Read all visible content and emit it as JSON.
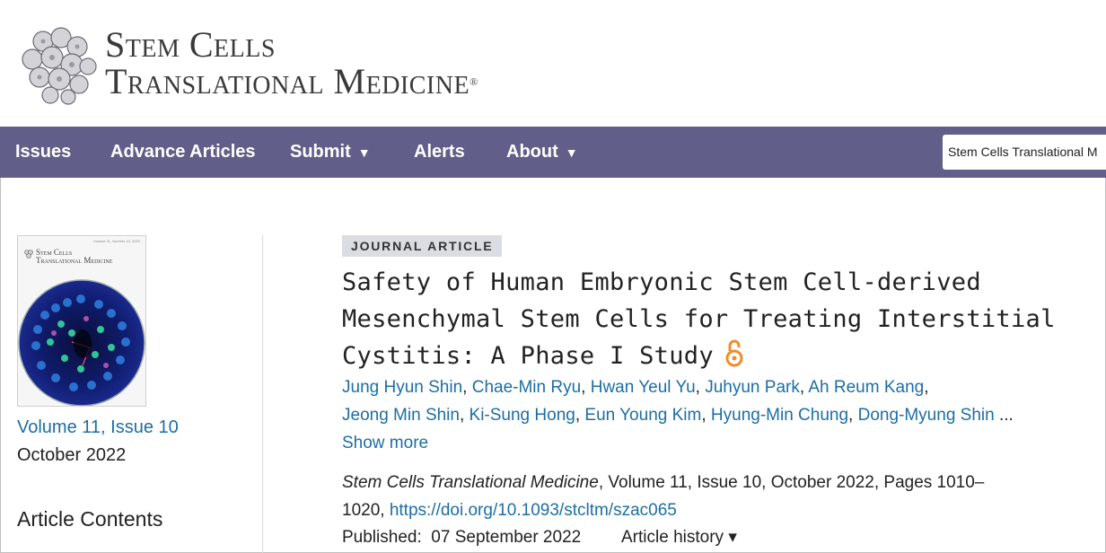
{
  "journal": {
    "logo_line1": "Stem Cells",
    "logo_line2": "Translational Medicine",
    "registered_mark": "®"
  },
  "nav": {
    "items": [
      {
        "label": "Issues"
      },
      {
        "label": "Advance Articles"
      },
      {
        "label": "Submit",
        "caret": "▼"
      },
      {
        "label": "Alerts"
      },
      {
        "label": "About",
        "caret": "▼"
      }
    ],
    "search_scope": "Stem Cells Translational M"
  },
  "sidebar": {
    "cover_title_line1": "Stem Cells",
    "cover_title_line2": "Translational Medicine",
    "cover_volume": "Volume 11, Number 10, 2022",
    "issue_link": "Volume 11, Issue 10",
    "issue_date": "October 2022",
    "contents_heading": "Article Contents"
  },
  "article": {
    "type_badge": "JOURNAL ARTICLE",
    "title": "Safety of Human Embryonic Stem Cell-derived Mesenchymal Stem Cells for Treating Interstitial Cystitis: A Phase I Study",
    "open_access_icon": "open-access-icon",
    "authors": [
      "Jung Hyun Shin",
      "Chae-Min Ryu",
      "Hwan Yeul Yu",
      "Juhyun Park",
      "Ah Reum Kang",
      "Jeong Min Shin",
      "Ki-Sung Hong",
      "Eun Young Kim",
      "Hyung-Min Chung",
      "Dong-Myung Shin"
    ],
    "authors_ellipsis": "...",
    "show_more": "Show more",
    "citation_journal": "Stem Cells Translational Medicine",
    "citation_rest": ", Volume 11, Issue 10, October 2022, Pages 1010–1020, ",
    "doi": "https://doi.org/10.1093/stcltm/szac065",
    "published_label": "Published:",
    "published_date": "07 September 2022",
    "history_label": "Article history",
    "history_caret": "▾"
  },
  "colors": {
    "nav_bg": "#615e89",
    "link": "#1c6ea4",
    "badge_bg": "#dcdde3",
    "oa_orange": "#f08c2a"
  }
}
